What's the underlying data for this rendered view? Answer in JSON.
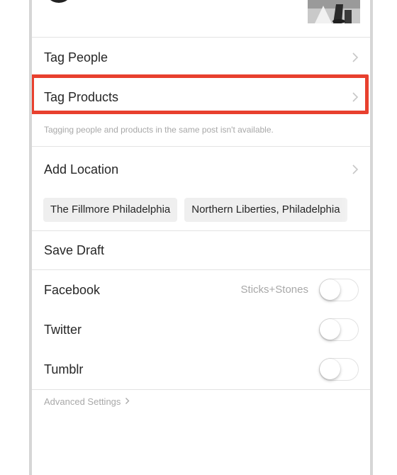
{
  "menu": {
    "tag_people": "Tag People",
    "tag_products": "Tag Products",
    "tagging_note": "Tagging people and products in the same post isn't available.",
    "add_location": "Add Location",
    "location_suggestions": [
      "The Fillmore Philadelphia",
      "Northern Liberties, Philadelphia"
    ],
    "save_draft": "Save Draft"
  },
  "share": {
    "facebook_label": "Facebook",
    "facebook_account": "Sticks+Stones",
    "facebook_on": false,
    "twitter_label": "Twitter",
    "twitter_on": false,
    "tumblr_label": "Tumblr",
    "tumblr_on": false
  },
  "advanced_settings": "Advanced Settings",
  "icons": {
    "chevron": "chevron-right-icon",
    "avatar": "avatar",
    "thumbnail": "post-thumbnail"
  },
  "colors": {
    "highlight": "#e8402e",
    "text": "#262626",
    "secondary_text": "#a8a8a8",
    "chip_bg": "#efefef",
    "divider": "#e3e3e3"
  }
}
